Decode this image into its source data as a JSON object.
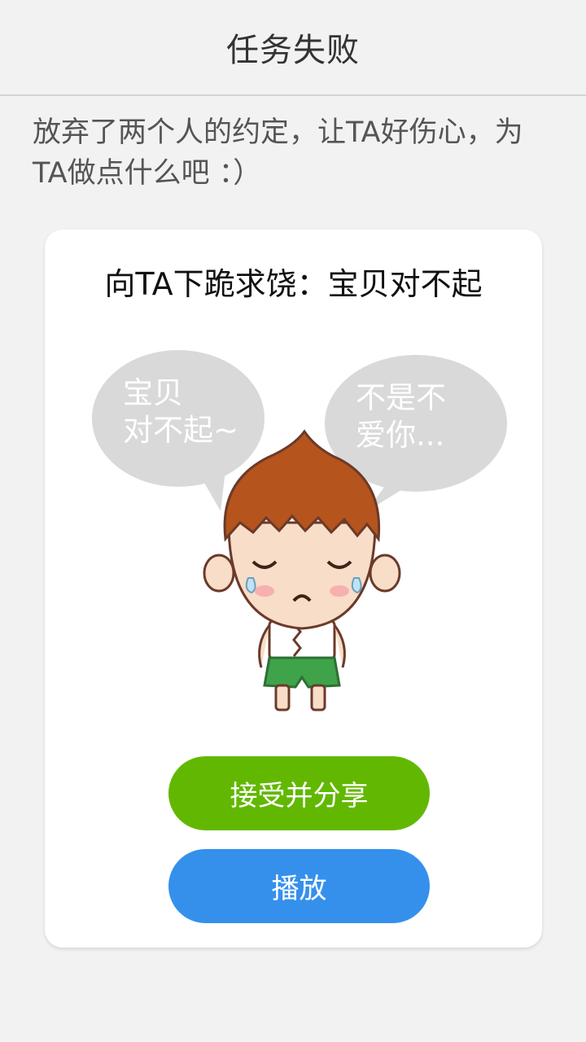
{
  "header": {
    "title": "任务失败"
  },
  "message": "放弃了两个人的约定，让TA好伤心，为TA做点什么吧 ：）",
  "card": {
    "title": "向TA下跪求饶：宝贝对不起",
    "illustration": {
      "left_bubble_lines": [
        "宝贝",
        "对不起~"
      ],
      "right_bubble_lines": [
        "不是不",
        "爱你..."
      ]
    },
    "accept_button": "接受并分享",
    "play_button": "播放"
  },
  "colors": {
    "accept": "#62b800",
    "play": "#3590ec",
    "bubble": "#d9d9d9",
    "hair": "#b5541c",
    "shorts": "#3fa34a"
  }
}
